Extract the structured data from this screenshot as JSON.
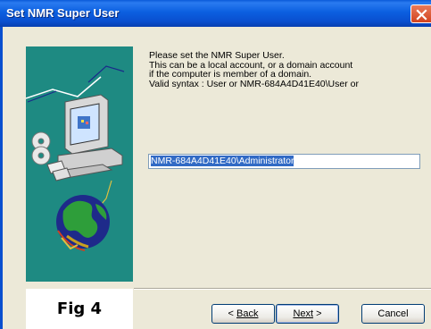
{
  "window": {
    "title": "Set NMR Super User"
  },
  "prompt": {
    "lines": [
      "Please set the NMR Super User.",
      "This can be a local account, or a domain account",
      "if the computer is member of a domain.",
      "Valid syntax : User  or  NMR-684A4D41E40\\User  or"
    ]
  },
  "user_field": {
    "value": "NMR-684A4D41E40\\Administrator"
  },
  "buttons": {
    "back": "Back",
    "next": "Next",
    "cancel": "Cancel"
  },
  "figure_label": "Fig 4",
  "colors": {
    "titlebar": "#0a4fcf",
    "art_background": "#1e8a82",
    "dialog": "#ece9d8",
    "selection": "#316ac5"
  },
  "icons": [
    "close-icon",
    "computer-icon",
    "cd-icon",
    "floppy-icon",
    "globe-icon",
    "network-cable-icon"
  ]
}
